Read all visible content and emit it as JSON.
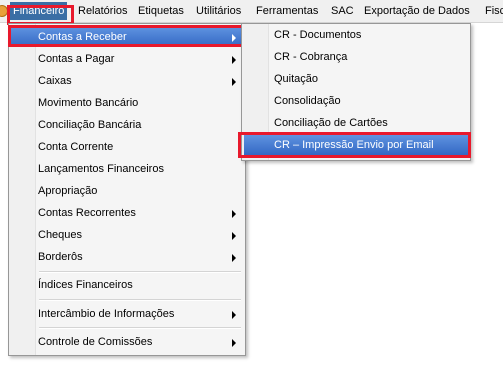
{
  "menubar": {
    "items": [
      "Financeiro",
      "Relatórios",
      "Etiquetas",
      "Utilitários",
      "Ferramentas",
      "SAC",
      "Exportação de Dados",
      "Fisc"
    ]
  },
  "financeiro_menu": {
    "items": [
      {
        "label": "Contas a Receber",
        "submenu": true,
        "selected": true
      },
      {
        "label": "Contas a Pagar",
        "submenu": true
      },
      {
        "label": "Caixas",
        "submenu": true
      },
      {
        "label": "Movimento Bancário",
        "submenu": false
      },
      {
        "label": "Conciliação Bancária",
        "submenu": false
      },
      {
        "label": "Conta Corrente",
        "submenu": false
      },
      {
        "label": "Lançamentos Financeiros",
        "submenu": false
      },
      {
        "label": "Apropriação",
        "submenu": false
      },
      {
        "label": "Contas Recorrentes",
        "submenu": true
      },
      {
        "label": "Cheques",
        "submenu": true
      },
      {
        "label": "Borderôs",
        "submenu": true
      },
      {
        "label": "Índices Financeiros",
        "submenu": false
      },
      {
        "label": "Intercâmbio de Informações",
        "submenu": true
      },
      {
        "label": "Controle de Comissões",
        "submenu": true
      }
    ]
  },
  "contas_receber_submenu": {
    "items": [
      {
        "label": "CR - Documentos"
      },
      {
        "label": "CR - Cobrança"
      },
      {
        "label": "Quitação"
      },
      {
        "label": "Consolidação"
      },
      {
        "label": "Conciliação de Cartões"
      },
      {
        "label": "CR – Impressão Envio por Email",
        "selected": true
      }
    ]
  },
  "colors": {
    "highlight_border": "#e8192c",
    "selection": "#3368c4"
  }
}
